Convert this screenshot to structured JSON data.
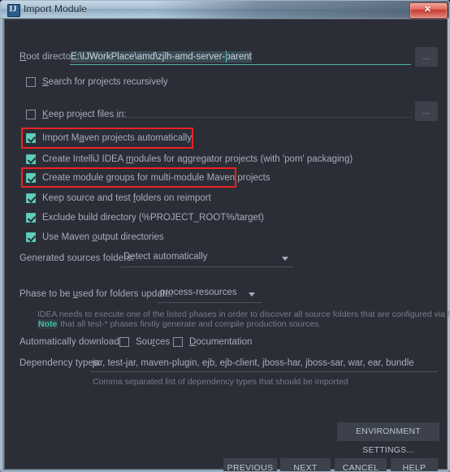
{
  "window": {
    "title": "Import Module",
    "icon": "intellij-idea-icon",
    "close_label": "✕"
  },
  "form": {
    "root_directory": {
      "label": "Root directory",
      "value": "E:\\IJWorkPlace\\amd\\zjlh-amd-server-parent",
      "browse_label": "..."
    },
    "keep_project_files": {
      "browse_label": "..."
    },
    "checkboxes": [
      {
        "label": "Search for projects recursively",
        "checked": false,
        "highlighted": false
      },
      {
        "label": "Keep project files in:",
        "checked": false,
        "highlighted": false
      },
      {
        "label": "Import Maven projects automatically",
        "checked": true,
        "highlighted": true
      },
      {
        "label": "Create IntelliJ IDEA modules for aggregator projects (with 'pom' packaging)",
        "checked": true,
        "highlighted": false
      },
      {
        "label": "Create module groups for multi-module Maven projects",
        "checked": true,
        "highlighted": true
      },
      {
        "label": "Keep source and test folders on reimport",
        "checked": true,
        "highlighted": false
      },
      {
        "label": "Exclude build directory (%PROJECT_ROOT%/target)",
        "checked": true,
        "highlighted": false
      },
      {
        "label": "Use Maven output directories",
        "checked": true,
        "highlighted": false
      }
    ],
    "generated_sources": {
      "label": "Generated sources folders:",
      "value": "Detect automatically"
    },
    "phase": {
      "label": "Phase to be used for folders update:",
      "value": "process-resources"
    },
    "help": {
      "line1": "IDEA needs to execute one of the listed phases in order to discover all source folders that are configured via Maven plugins.",
      "note": "Note",
      "line2_rest": " that all test-* phases firstly generate and compile production sources."
    },
    "auto_download": {
      "label": "Automatically download:",
      "sources": {
        "label": "Sources",
        "checked": false
      },
      "documentation": {
        "label": "Documentation",
        "checked": false
      }
    },
    "dependency_types": {
      "label": "Dependency types:",
      "value": "jar, test-jar, maven-plugin, ejb, ejb-client, jboss-har, jboss-sar, war, ear, bundle",
      "hint": "Comma separated list of dependency types that should be imported"
    }
  },
  "buttons": {
    "environment_settings": "ENVIRONMENT SETTINGS...",
    "previous": "PREVIOUS",
    "next": "NEXT",
    "cancel": "CANCEL",
    "help": "HELP"
  },
  "colors": {
    "accent_teal": "#4db6ac",
    "checkbox_checked": "#63cdbb",
    "highlight_red": "#ee2222",
    "dialog_bg": "#2b2e37",
    "text": "#a6adbb"
  }
}
